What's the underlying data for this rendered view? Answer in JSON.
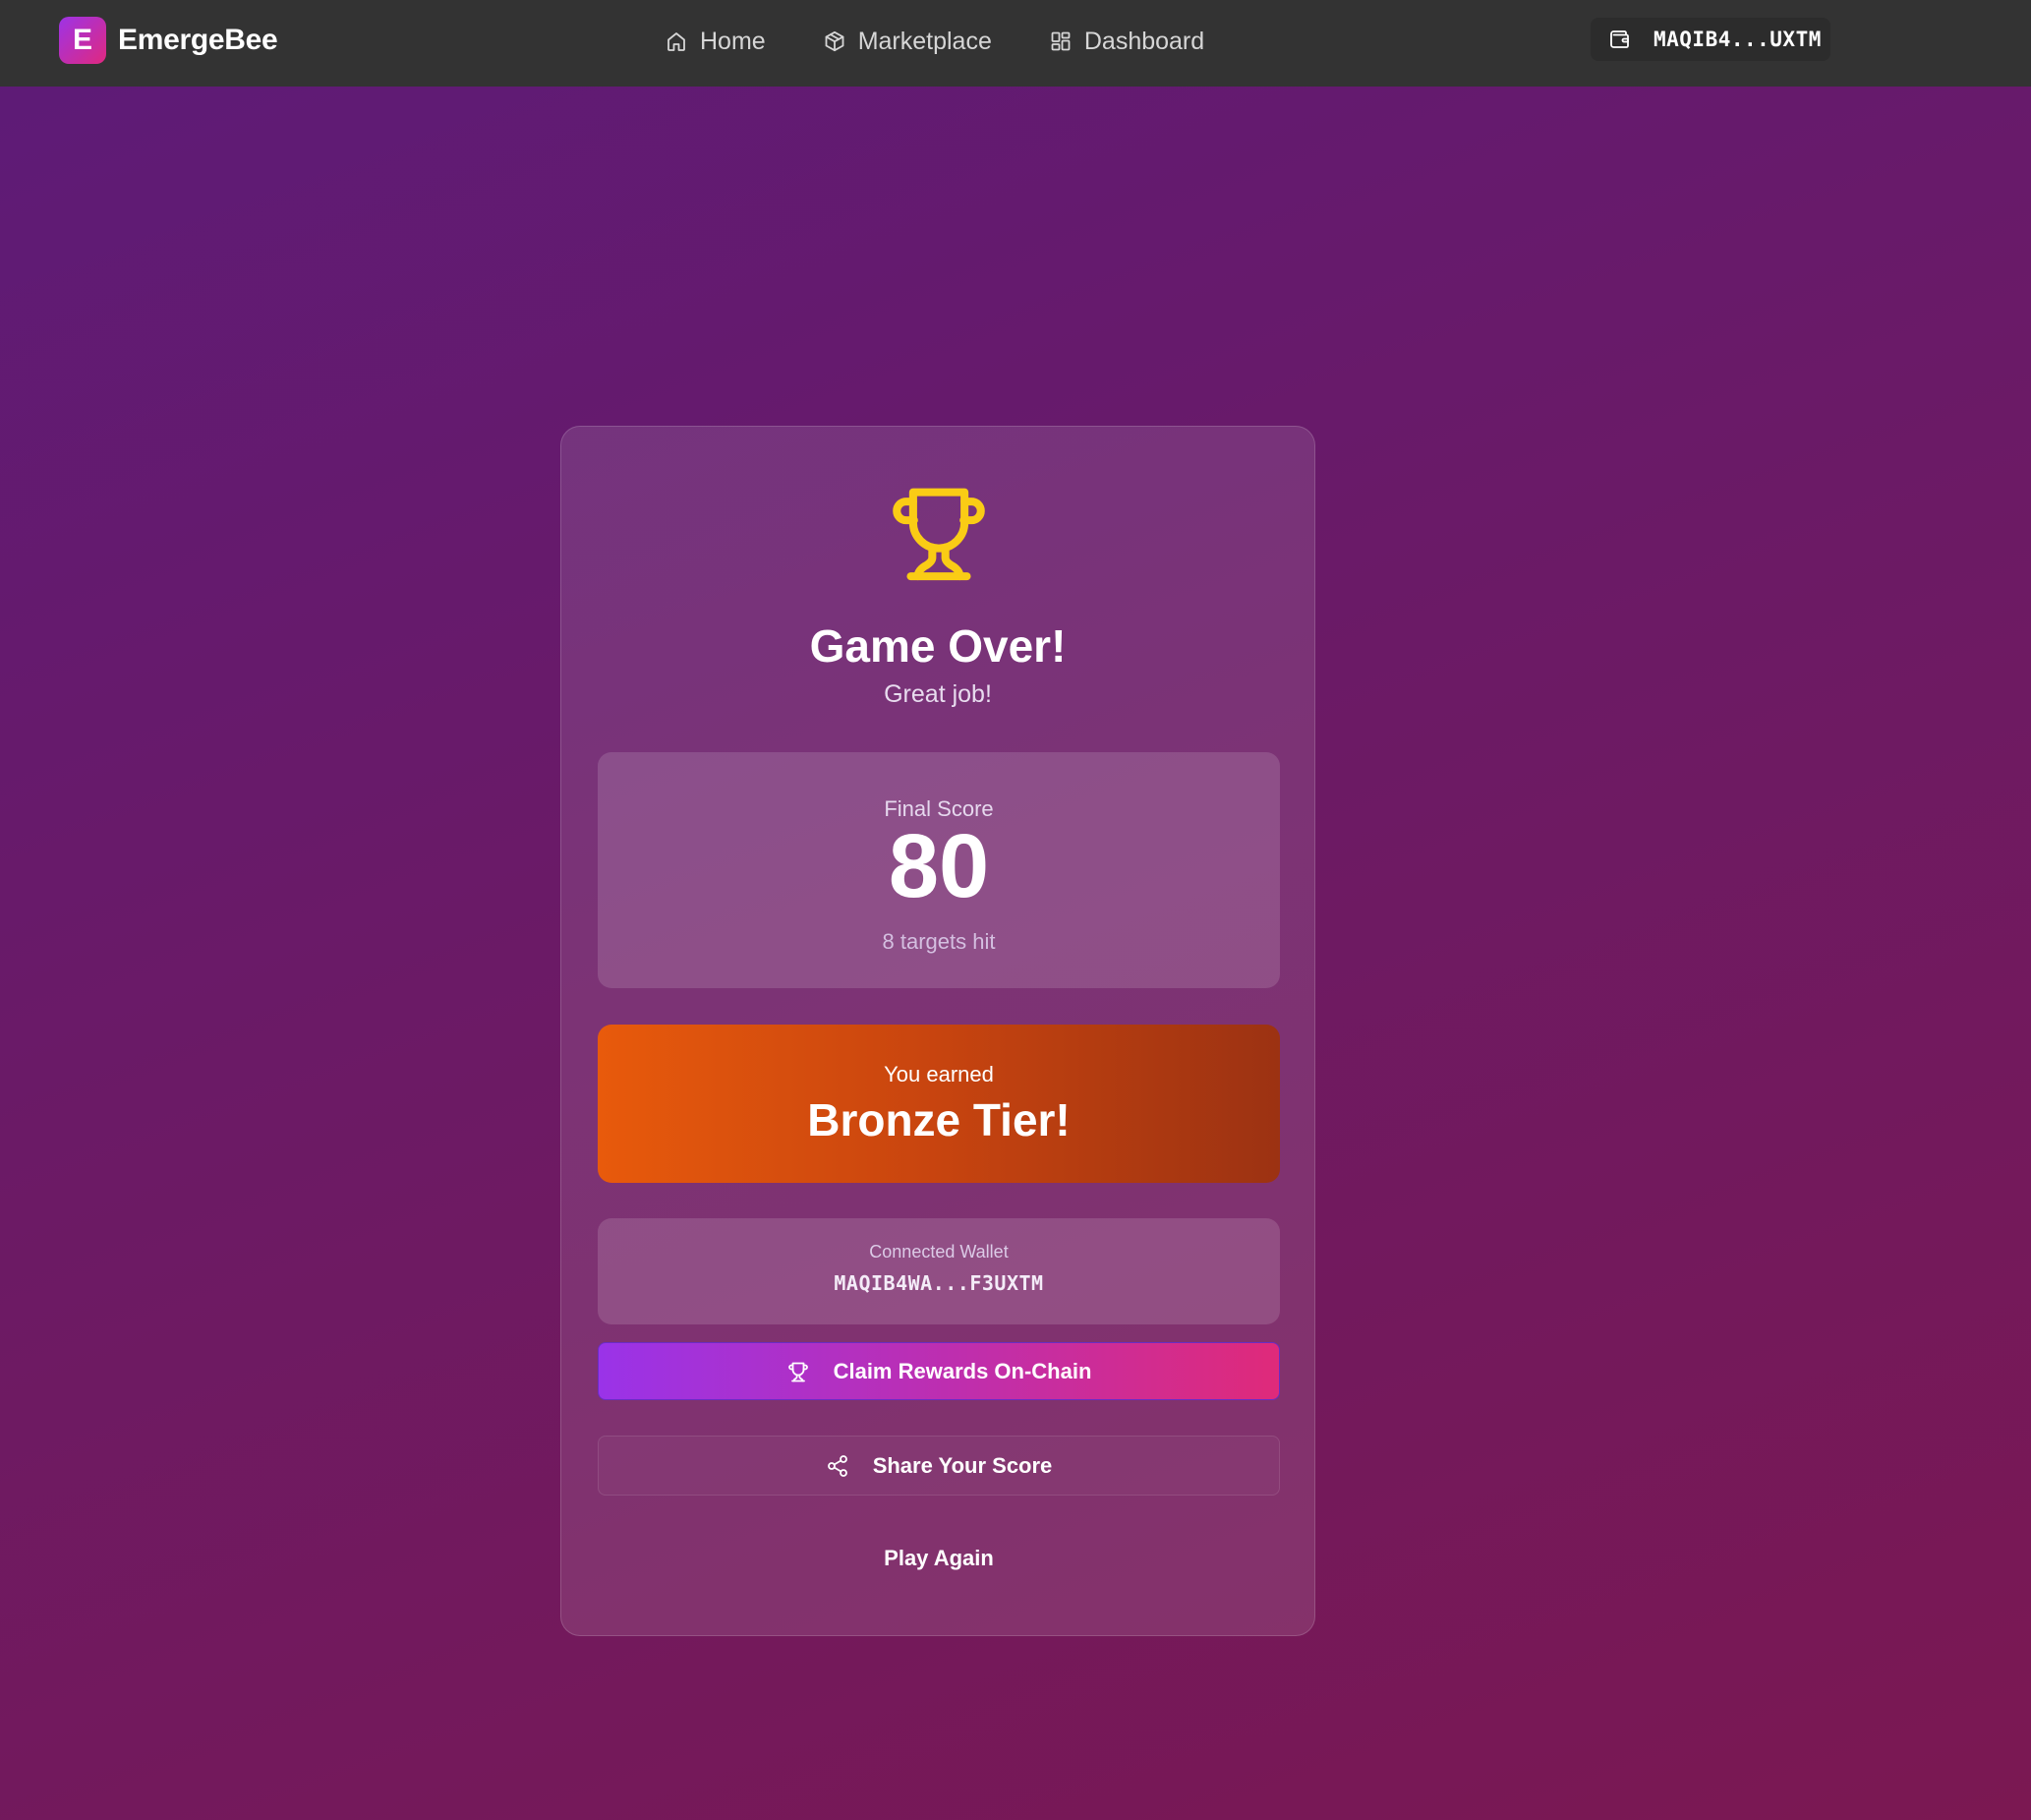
{
  "brand": {
    "logo_letter": "E",
    "name": "EmergeBee"
  },
  "nav": {
    "items": [
      {
        "label": "Home",
        "icon": "home-icon"
      },
      {
        "label": "Marketplace",
        "icon": "cube-icon"
      },
      {
        "label": "Dashboard",
        "icon": "grid-icon"
      }
    ]
  },
  "wallet_chip": {
    "icon": "wallet-icon",
    "address": "MAQIB4...UXTM"
  },
  "result": {
    "icon": "trophy-icon",
    "title": "Game Over!",
    "subtitle": "Great job!",
    "score": {
      "label": "Final Score",
      "value": "80",
      "targets": "8 targets hit"
    },
    "tier": {
      "label": "You earned",
      "value": "Bronze Tier!"
    },
    "wallet": {
      "label": "Connected Wallet",
      "address": "MAQIB4WA...F3UXTM"
    },
    "buttons": {
      "claim": "Claim Rewards On-Chain",
      "share": "Share Your Score",
      "play_again": "Play Again"
    }
  },
  "colors": {
    "topbar": "#333333",
    "background_start": "#5d1b78",
    "background_end": "#7b1852",
    "trophy": "#facc15",
    "tier_start": "#e85a0c",
    "tier_end": "#9c3212",
    "claim_start": "#9a33e8",
    "claim_end": "#df2a7a"
  }
}
